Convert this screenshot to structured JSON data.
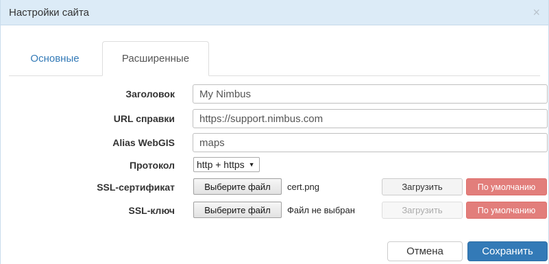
{
  "dialog": {
    "title": "Настройки сайта",
    "close_glyph": "×"
  },
  "tabs": [
    {
      "label": "Основные",
      "active": false
    },
    {
      "label": "Расширенные",
      "active": true
    }
  ],
  "form": {
    "title_label": "Заголовок",
    "title_value": "My Nimbus",
    "help_url_label": "URL справки",
    "help_url_value": "https://support.nimbus.com",
    "alias_label": "Alias WebGIS",
    "alias_value": "maps",
    "protocol_label": "Протокол",
    "protocol_value": "http + https",
    "ssl_cert_label": "SSL-сертификат",
    "ssl_cert_choose": "Выберите файл",
    "ssl_cert_file": "cert.png",
    "ssl_cert_upload": "Загрузить",
    "ssl_cert_default": "По умолчанию",
    "ssl_key_label": "SSL-ключ",
    "ssl_key_choose": "Выберите файл",
    "ssl_key_file": "Файл не выбран",
    "ssl_key_upload": "Загрузить",
    "ssl_key_default": "По умолчанию"
  },
  "footer": {
    "cancel_label": "Отмена",
    "save_label": "Сохранить"
  },
  "colors": {
    "titlebar_bg": "#dcebf7",
    "link": "#337ab7",
    "primary": "#337ab7",
    "danger": "#d9534f"
  }
}
